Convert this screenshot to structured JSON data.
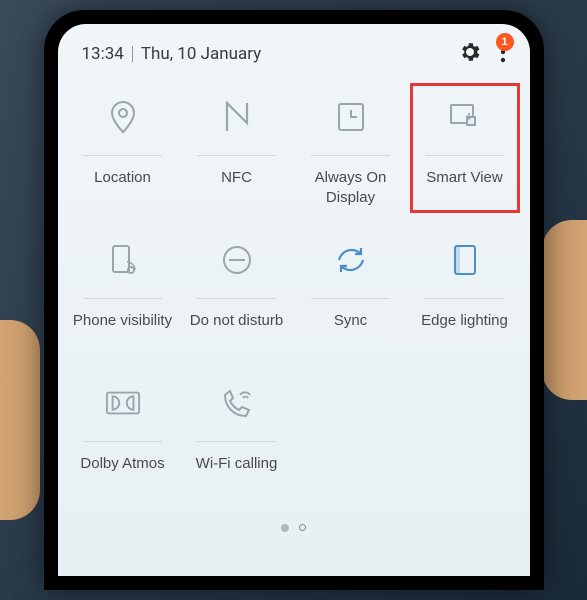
{
  "status": {
    "time": "13:34",
    "date": "Thu, 10 January",
    "badge_count": "1"
  },
  "tiles": [
    {
      "label": "Location"
    },
    {
      "label": "NFC"
    },
    {
      "label": "Always On Display"
    },
    {
      "label": "Smart View"
    },
    {
      "label": "Phone visibility"
    },
    {
      "label": "Do not disturb"
    },
    {
      "label": "Sync"
    },
    {
      "label": "Edge lighting"
    },
    {
      "label": "Dolby Atmos"
    },
    {
      "label": "Wi-Fi calling"
    }
  ],
  "colors": {
    "icon_gray": "#9aa5ab",
    "icon_blue": "#4a8fc7",
    "highlight": "#e53935",
    "badge": "#ff5722"
  },
  "pagination": {
    "current": 1,
    "total": 2
  }
}
